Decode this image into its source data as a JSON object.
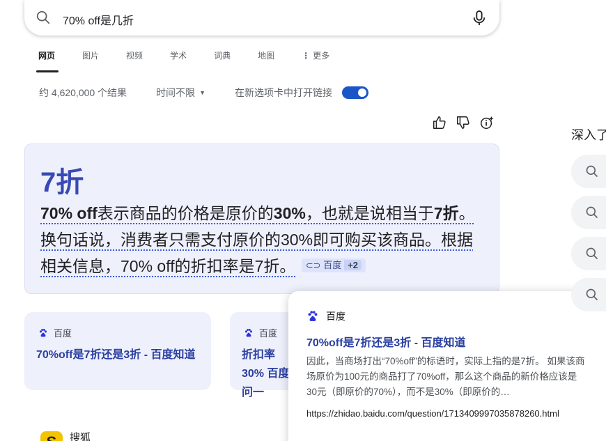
{
  "search": {
    "query": "70% off是几折"
  },
  "tabs": [
    {
      "label": "网页",
      "active": true
    },
    {
      "label": "图片"
    },
    {
      "label": "视频"
    },
    {
      "label": "学术"
    },
    {
      "label": "词典"
    },
    {
      "label": "地图"
    },
    {
      "label": "更多"
    }
  ],
  "info": {
    "result_count": "约 4,620,000 个结果",
    "time_filter": "时间不限",
    "new_tab_label": "在新选项卡中打开链接"
  },
  "answer": {
    "headline": "7折",
    "b1": "70% off",
    "t1": "表示商品的价格是原价的",
    "b2": "30%",
    "t2": "，也就是说相当于",
    "b3": "7折",
    "t3": "。换句话说，消费者只需支付原价的30%即可购买该商品。根据相关信息，70% off的折扣率是7折。",
    "cite_source": "百度",
    "cite_more": "+2"
  },
  "cards": [
    {
      "source": "百度",
      "title": "70%off是7折还是3折 - 百度知道"
    },
    {
      "source": "百度",
      "title": "折扣率30% 百度问一"
    }
  ],
  "popup": {
    "source": "百度",
    "title": "70%off是7折还是3折 - 百度知道",
    "snippet": "因此，当商场打出“70%off”的标语时，实际上指的是7折。 如果该商场原价为100元的商品打了70%off，那么这个商品的新价格应该是30元（即原价的70%），而不是30%（即原价的…",
    "url": "https://zhidao.baidu.com/question/1713409997035878260.html"
  },
  "sidebar": {
    "heading": "深入了"
  },
  "next_result": {
    "source": "搜狐",
    "logo_letter": "S"
  },
  "colors": {
    "accent": "#3949b3",
    "toggle": "#1a56c8",
    "card_bg": "#eef0fc"
  }
}
